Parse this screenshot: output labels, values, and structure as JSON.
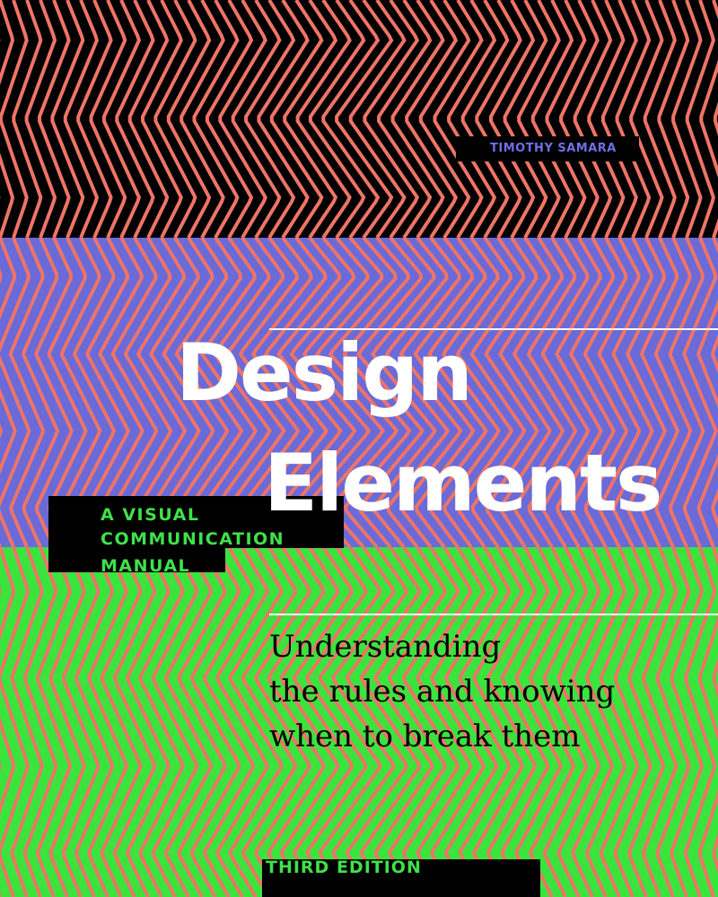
{
  "cover": {
    "author": "TIMOTHY SAMARA",
    "title_lines": [
      "Design",
      "Elements"
    ],
    "series_label_lines": [
      "A VISUAL",
      "COMMUNICATION",
      "MANUAL"
    ],
    "subtitle_lines": [
      "Understanding",
      "the rules and knowing",
      "when to break them"
    ],
    "edition": "THIRD EDITION"
  },
  "colors": {
    "stripe": "#ee7467",
    "band_top": "#000000",
    "band_mid": "#6a6ad8",
    "band_bottom": "#39e43d",
    "author_text": "#6f6fe6",
    "label_text": "#3fe14a",
    "title_text": "#ffffff"
  }
}
